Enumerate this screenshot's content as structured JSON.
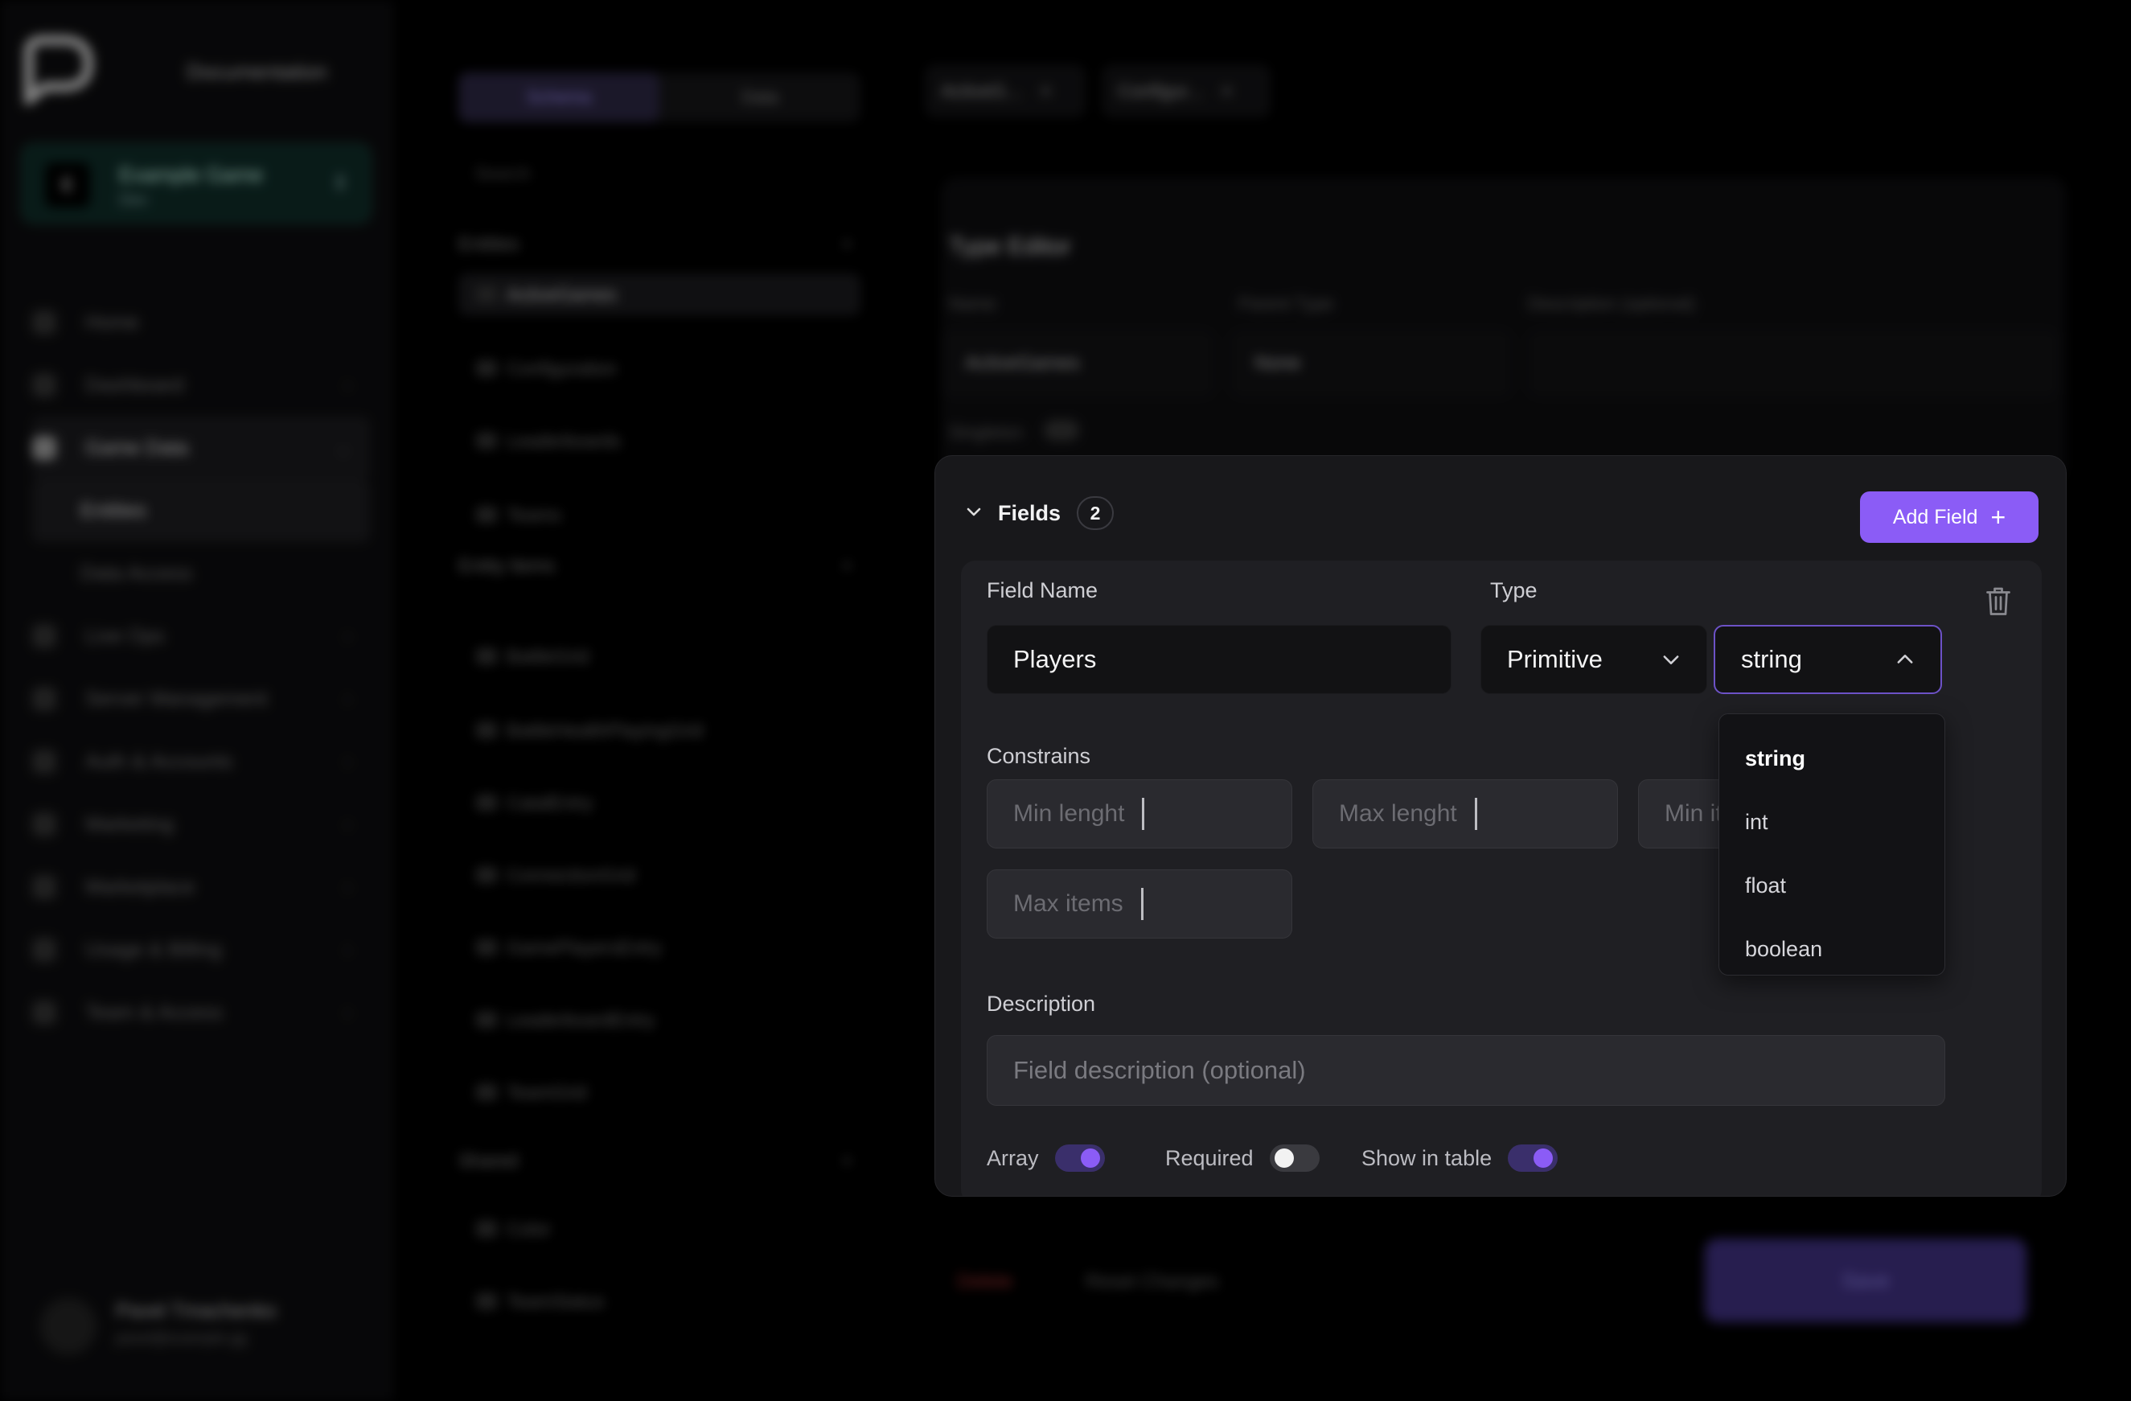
{
  "background": {
    "documentation_label": "Documentation",
    "project": {
      "avatar": "E",
      "name": "Example Game",
      "sub": "Dev"
    },
    "nav": [
      {
        "label": "Home"
      },
      {
        "label": "Dashboard"
      },
      {
        "label": "Game Data"
      },
      {
        "label": "Entities"
      },
      {
        "label": "Data Access"
      },
      {
        "label": "Live Ops"
      },
      {
        "label": "Server Management"
      },
      {
        "label": "Auth & Accounts"
      },
      {
        "label": "Marketing"
      },
      {
        "label": "Marketplace"
      },
      {
        "label": "Usage & Billing"
      },
      {
        "label": "Team & Access"
      }
    ],
    "user": {
      "name": "Pavel Tmachenko",
      "email": "pavel@example.gg"
    },
    "segments": {
      "a": "Schema",
      "b": "Data"
    },
    "search_placeholder": "Search",
    "groups": {
      "entities": "Entities",
      "entity_items": "Entity Items",
      "shared": "Shared"
    },
    "entities": [
      "ActiveGames",
      "Configuration",
      "Leaderboards",
      "Teams"
    ],
    "entity_items": [
      "BattleGrid",
      "BattleHealthPlayingGrid",
      "CatalEntry",
      "ConnectionGrid",
      "GamePlayersEntry",
      "LeaderboardEntry",
      "TeamGrid"
    ],
    "shared": [
      "Color",
      "TeamStatus"
    ],
    "tabs": [
      "ActiveG...",
      "Configur..."
    ],
    "type_editor": {
      "title": "Type Editor",
      "name_label": "Name",
      "parent_label": "Parent Type",
      "desc_label": "Description (optional)",
      "name_value": "ActiveGames",
      "parent_value": "None",
      "singleton_label": "Singleton"
    },
    "bottom": {
      "delete": "Delete",
      "reset": "Reset Changes",
      "save": "Save"
    }
  },
  "fields_panel": {
    "title": "Fields",
    "count": "2",
    "add_button": "Add Field",
    "field": {
      "name_label": "Field Name",
      "name_value": "Players",
      "type_label": "Type",
      "type_value": "Primitive",
      "primitive_value": "string",
      "constraints_label": "Constrains",
      "min_length_placeholder": "Min lenght",
      "max_length_placeholder": "Max lenght",
      "min_items_placeholder": "Min items",
      "max_items_placeholder": "Max items",
      "description_label": "Description",
      "description_placeholder": "Field description (optional)",
      "toggles": [
        {
          "label": "Array",
          "on": true
        },
        {
          "label": "Required",
          "on": false
        },
        {
          "label": "Show in table",
          "on": true
        }
      ]
    }
  },
  "dropdown": {
    "options": [
      "string",
      "int",
      "float",
      "boolean"
    ],
    "selected": "string"
  },
  "colors": {
    "accent": "#8b5cf6",
    "panel": "#18181b",
    "card": "#1f1f23"
  }
}
